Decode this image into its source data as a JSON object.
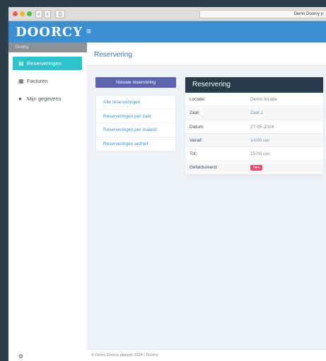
{
  "browser": {
    "url_title": "Demo Doorcy p",
    "nav_back": "‹",
    "nav_forward": "›",
    "sidebar_toggle": "▯"
  },
  "app": {
    "logo": "DOORCY",
    "menu_icon": "≡"
  },
  "sidebar": {
    "header": "Doorcy",
    "items": [
      {
        "label": "Reserveringen",
        "icon": "calendar-icon",
        "active": true
      },
      {
        "label": "Facturen",
        "icon": "invoice-icon",
        "active": false
      },
      {
        "label": "Mijn gegevens",
        "icon": "user-icon",
        "active": false
      }
    ],
    "settings_icon": "⚙"
  },
  "page": {
    "title": "Reservering"
  },
  "actions": {
    "new_button": "Nieuwe reservering"
  },
  "list": {
    "items": [
      "Alle reserveringen",
      "Reserveringen per zaal",
      "Reserveringen per maand",
      "Reserveringen archief"
    ]
  },
  "detail": {
    "title": "Reservering",
    "rows": [
      {
        "label": "Locatie:",
        "value": "Demo locatie"
      },
      {
        "label": "Zaal:",
        "value": "Zaal 1"
      },
      {
        "label": "Datum:",
        "value": "27-05-2024"
      },
      {
        "label": "Vanaf:",
        "value": "14:00 uur"
      },
      {
        "label": "Tot:",
        "value": "15:00 uur"
      }
    ],
    "invoiced_label": "Gefactureerd:",
    "invoiced_badge": "Nee"
  },
  "footer": {
    "text": "© Demo Doorcy planner 2024 | Doorcy"
  },
  "colors": {
    "topbar": "#3a8fd3",
    "active_sidebar": "#2ec3c8",
    "primary_button": "#5a64b0",
    "detail_header": "#263a47",
    "badge": "#e74c6b"
  }
}
